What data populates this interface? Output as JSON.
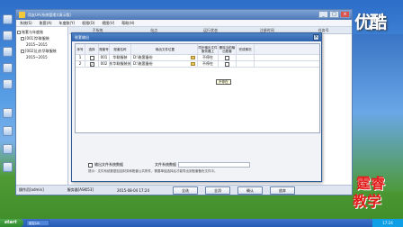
{
  "watermark": {
    "top": "优酷",
    "bottom_line1": "霆睿",
    "bottom_line2": "教学"
  },
  "app": {
    "title": "用友UA(系统管理)(演示版)",
    "window_buttons": [
      "_",
      "□",
      "×"
    ],
    "menu": [
      "系统(S)",
      "账套(A)",
      "年度账(Y)",
      "权限(O)",
      "视图(V)",
      "帮助(H)"
    ],
    "tree": [
      "账套与年度账",
      "[001]华联服装",
      "2015~2015",
      "[002]山东华联服装",
      "2015~2015"
    ],
    "columns": [
      "子系统",
      "站点",
      "运行状态",
      "注册时间",
      "任务号"
    ],
    "status": [
      "操作员[admin]",
      "服务器[ASKI53]",
      "2015-08-04 17:24",
      "[用友软件]"
    ]
  },
  "dialog": {
    "title": "账套输出",
    "close": "×",
    "headers": [
      "序号",
      "选择",
      "账套号",
      "账套名称",
      "输出文件位置",
      "同步输出文件服务器上",
      "删除当前输出账套",
      "完成情况"
    ],
    "rows": [
      {
        "seq": "1",
        "selected": false,
        "code": "001",
        "name": "华联服装",
        "path": "D:\\账套备份",
        "sync": "不停在",
        "delete": false,
        "done": ""
      },
      {
        "seq": "2",
        "selected": true,
        "code": "002",
        "name": "山东华联服装技术",
        "path": "D:\\账套备份",
        "sync": "不停在",
        "delete": false,
        "done": ""
      }
    ],
    "tooltip": "不停在",
    "option1": "输出文件系统数据",
    "option2": "文件系统数据",
    "hint": "提示：文件系统数据包括财务和账套公共附件，需要单独选择后才能导出到账套备份文件中。",
    "buttons": [
      "全选",
      "全消",
      "确认",
      "放弃"
    ]
  },
  "taskbar": {
    "start": "start",
    "item": "用友UA",
    "tray": "17:24"
  }
}
